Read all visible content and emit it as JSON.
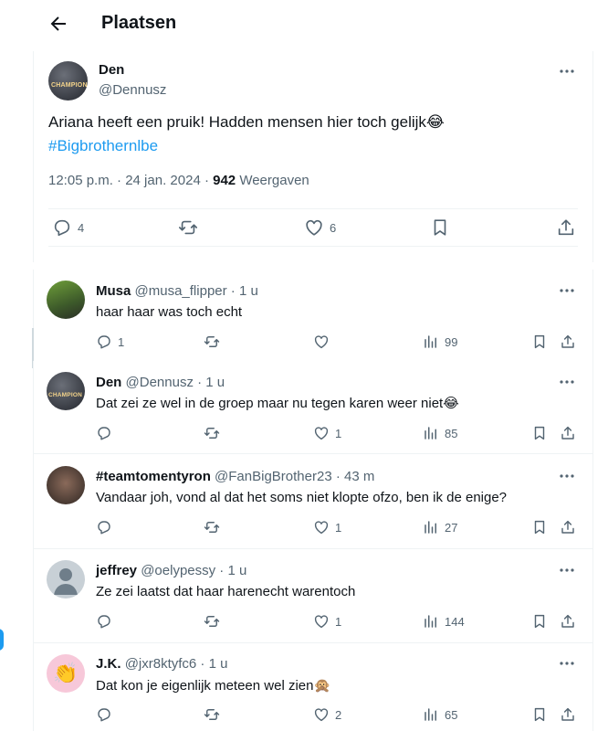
{
  "header": {
    "title": "Plaatsen",
    "back_icon": "arrow-left-icon"
  },
  "post": {
    "author_name": "Den",
    "author_handle": "@Dennusz",
    "avatar_text": "CHAMPION",
    "text": "Ariana heeft een pruik! Hadden mensen hier toch gelijk😂",
    "hashtag": "#Bigbrothernlbe",
    "time": "12:05 p.m. · 24 jan. 2024 · ",
    "views_count": "942",
    "views_label": " Weergaven",
    "replies": "4",
    "likes": "6"
  },
  "replies": [
    {
      "name": "Musa",
      "handle": "@musa_flipper · 1 u",
      "text": "haar haar was toch echt",
      "replies": "1",
      "retweets": "",
      "likes": "",
      "views": "99"
    },
    {
      "name": "Den",
      "handle": "@Dennusz · 1 u",
      "text": "Dat zei ze wel in de groep maar nu tegen karen weer niet😂",
      "replies": "",
      "retweets": "",
      "likes": "1",
      "views": "85"
    },
    {
      "name": "#teamtomentyron",
      "handle": "@FanBigBrother23 · 43 m",
      "text": "Vandaar joh, vond al dat het soms niet klopte ofzo, ben ik de enige?",
      "replies": "",
      "retweets": "",
      "likes": "1",
      "views": "27"
    },
    {
      "name": "jeffrey",
      "handle": "@oelypessy · 1 u",
      "text": "Ze zei laatst dat haar harenecht warentoch",
      "replies": "",
      "retweets": "",
      "likes": "1",
      "views": "144"
    },
    {
      "name": "J.K.",
      "handle": "@jxr8ktyfc6 · 1 u",
      "text": "Dat kon je eigenlijk meteen wel zien🙊",
      "replies": "",
      "retweets": "",
      "likes": "2",
      "views": "65"
    }
  ],
  "colors": {
    "accent": "#1d9bf0",
    "text": "#0f1419",
    "muted": "#536471",
    "border": "#eff3f4"
  }
}
